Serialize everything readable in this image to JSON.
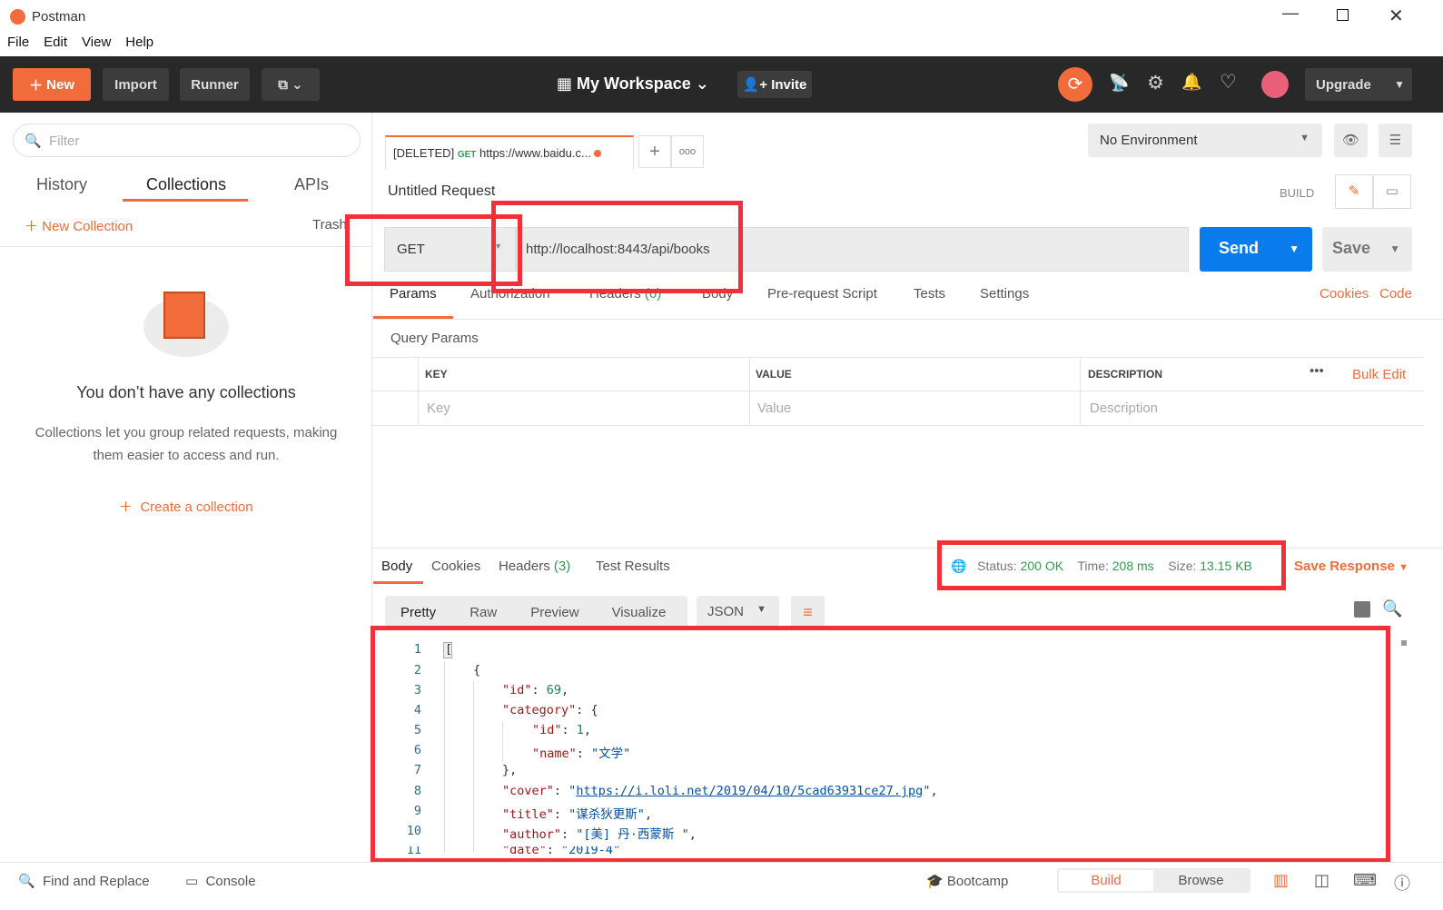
{
  "window": {
    "title": "Postman",
    "menu": [
      "File",
      "Edit",
      "View",
      "Help"
    ]
  },
  "header": {
    "new": "New",
    "import": "Import",
    "runner": "Runner",
    "workspace": "My Workspace",
    "invite": "Invite",
    "upgrade": "Upgrade"
  },
  "sidebar": {
    "filter_placeholder": "Filter",
    "tabs": [
      "History",
      "Collections",
      "APIs"
    ],
    "new_collection": "New Collection",
    "trash": "Trash",
    "empty_title": "You don’t have any collections",
    "empty_desc_1": "Collections let you group related requests, making",
    "empty_desc_2": "them easier to access and run.",
    "create": "Create a collection"
  },
  "request_tab": {
    "deleted": "[DELETED]",
    "method": "GET",
    "url": "https://www.baidu.c..."
  },
  "environment": {
    "selected": "No Environment"
  },
  "request": {
    "title": "Untitled Request",
    "build": "BUILD",
    "method": "GET",
    "url": "http://localhost:8443/api/books",
    "send": "Send",
    "save": "Save",
    "tabs": [
      "Params",
      "Authorization",
      "Headers",
      "Body",
      "Pre-request Script",
      "Tests",
      "Settings"
    ],
    "headers_count": "(6)",
    "cookies": "Cookies",
    "code": "Code",
    "query_params": "Query Params",
    "columns": [
      "KEY",
      "VALUE",
      "DESCRIPTION"
    ],
    "bulk_edit": "Bulk Edit",
    "placeholders": [
      "Key",
      "Value",
      "Description"
    ]
  },
  "response": {
    "tabs": [
      "Body",
      "Cookies",
      "Headers",
      "Test Results"
    ],
    "headers_count": "(3)",
    "status_label": "Status:",
    "status": "200 OK",
    "time_label": "Time:",
    "time": "208 ms",
    "size_label": "Size:",
    "size": "13.15 KB",
    "save_response": "Save Response",
    "views": [
      "Pretty",
      "Raw",
      "Preview",
      "Visualize"
    ],
    "format": "JSON",
    "lines": [
      "1",
      "2",
      "3",
      "4",
      "5",
      "6",
      "7",
      "8",
      "9",
      "10",
      "11"
    ],
    "json": {
      "id_key": "\"id\"",
      "id": "69",
      "category_key": "\"category\"",
      "cat_id": "1",
      "name_key": "\"name\"",
      "name": "\"文学\"",
      "cover_key": "\"cover\"",
      "cover": "https://i.loli.net/2019/04/10/5cad63931ce27.jpg",
      "title_key": "\"title\"",
      "title": "\"谋杀狄更斯\"",
      "author_key": "\"author\"",
      "author": "\"[美] 丹·西蒙斯 \"",
      "date_key": "\"date\"",
      "date": "\"2019-4\""
    }
  },
  "footer": {
    "find": "Find and Replace",
    "console": "Console",
    "bootcamp": "Bootcamp",
    "build": "Build",
    "browse": "Browse"
  },
  "colors": {
    "accent": "#f26b3a",
    "send": "#097bed",
    "success": "#2e9d4e",
    "highlight": "#f2303a"
  }
}
